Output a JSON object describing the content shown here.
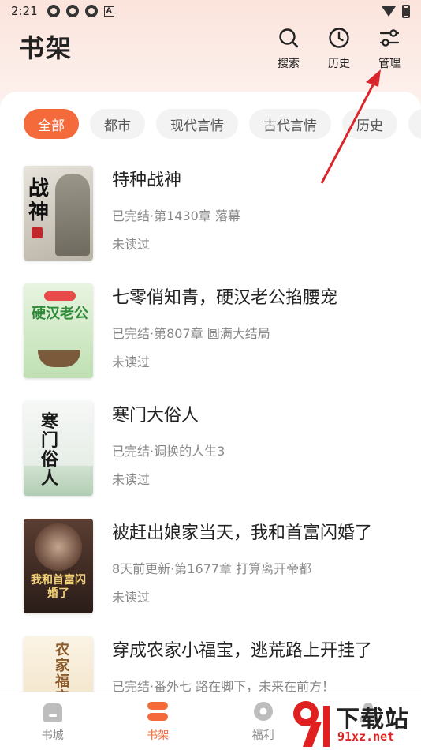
{
  "status_bar": {
    "time": "2:21"
  },
  "header": {
    "title": "书架",
    "actions": [
      {
        "label": "搜索",
        "icon": "search-icon"
      },
      {
        "label": "历史",
        "icon": "history-icon"
      },
      {
        "label": "管理",
        "icon": "manage-icon"
      }
    ]
  },
  "tabs": [
    "全部",
    "都市",
    "现代言情",
    "古代言情",
    "历史",
    ""
  ],
  "books": [
    {
      "title": "特种战神",
      "status": "已完结·第1430章 落幕",
      "read": "未读过",
      "cover_text": "战神",
      "cover_color": "#d9d4cc"
    },
    {
      "title": "七零俏知青，硬汉老公掐腰宠",
      "status": "已完结·第807章 圆满大结局",
      "read": "未读过",
      "cover_text": "硬汉老公",
      "cover_color": "#cfe8c9"
    },
    {
      "title": "寒门大俗人",
      "status": "已完结·调换的人生3",
      "read": "未读过",
      "cover_text": "寒门俗人",
      "cover_color": "#eef2ee"
    },
    {
      "title": "被赶出娘家当天，我和首富闪婚了",
      "status": "8天前更新·第1677章 打算离开帝都",
      "read": "未读过",
      "cover_text": "我和首富闪婚了",
      "cover_color": "#3a2a24"
    },
    {
      "title": "穿成农家小福宝，逃荒路上开挂了",
      "status": "已完结·番外七 路在脚下，未来在前方！",
      "read": "",
      "cover_text": "农家福宝",
      "cover_color": "#f4ead8"
    }
  ],
  "bottom_nav": [
    {
      "label": "书城",
      "icon": "bookstore-icon"
    },
    {
      "label": "书架",
      "icon": "bookshelf-icon",
      "active": true
    },
    {
      "label": "福利",
      "icon": "welfare-icon"
    },
    {
      "label": "",
      "icon": "profile-icon"
    }
  ],
  "watermark": {
    "text": "下载站",
    "url": "91xz.net"
  },
  "colors": {
    "accent": "#f46a3a",
    "annotation_arrow": "#d9262c"
  }
}
